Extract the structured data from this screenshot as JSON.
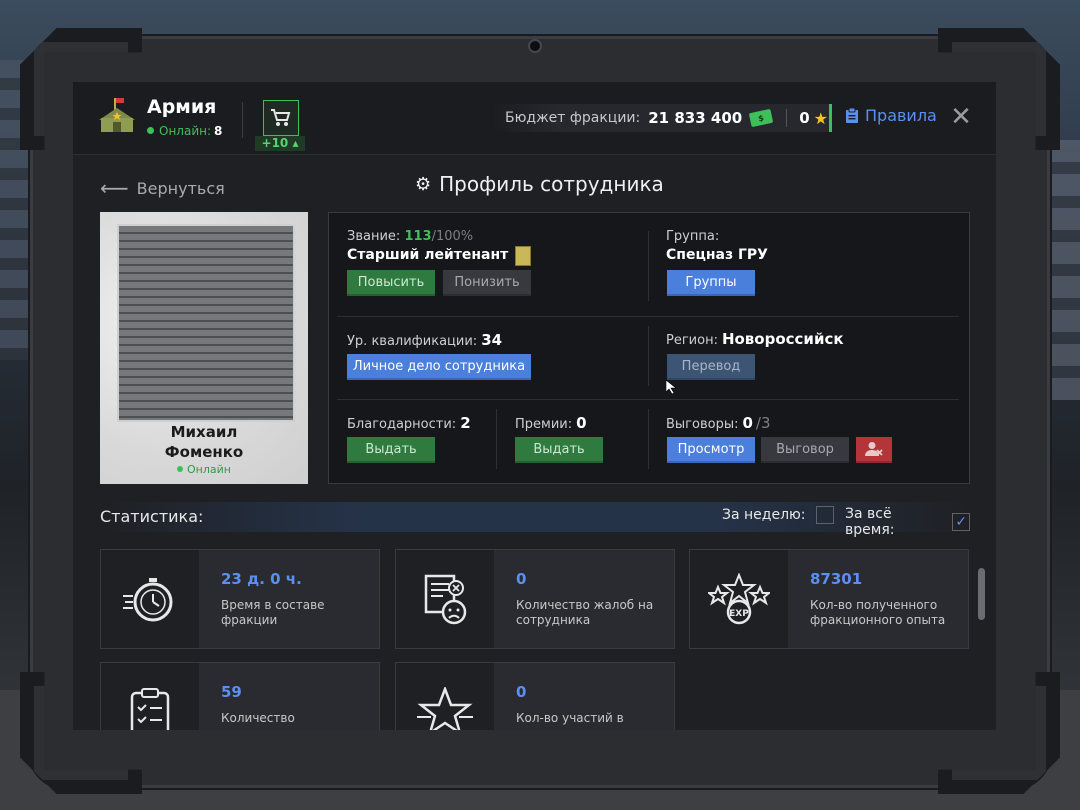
{
  "header": {
    "faction_name": "Армия",
    "online_label": "Онлайн:",
    "online_count": "8",
    "shop_bonus": "+10",
    "budget_label": "Бюджет фракции:",
    "budget_value": "21 833 400",
    "money_icon_text": "$",
    "stars_value": "0",
    "rules_label": "Правила"
  },
  "nav": {
    "back_label": "Вернуться",
    "page_title": "Профиль сотрудника"
  },
  "profile": {
    "first_name": "Михаил",
    "last_name": "Фоменко",
    "status": "Онлайн"
  },
  "info": {
    "rank_label": "Звание:",
    "rank_progress": "113",
    "rank_progress_max": "/100%",
    "rank_name": "Старший лейтенант",
    "promote_btn": "Повысить",
    "demote_btn": "Понизить",
    "group_label": "Группа:",
    "group_name": "Спецназ ГРУ",
    "groups_btn": "Группы",
    "qual_label": "Ур. квалификации:",
    "qual_value": "34",
    "personal_file_btn": "Личное дело сотрудника",
    "region_label": "Регион:",
    "region_name": "Новороссийск",
    "transfer_btn": "Перевод",
    "thanks_label": "Благодарности:",
    "thanks_value": "2",
    "thanks_btn": "Выдать",
    "bonus_label": "Премии:",
    "bonus_value": "0",
    "bonus_btn": "Выдать",
    "reprimand_label": "Выговоры:",
    "reprimand_value": "0",
    "reprimand_max": "/3",
    "view_btn": "Просмотр",
    "reprimand_btn": "Выговор"
  },
  "stats": {
    "title": "Статистика:",
    "week_label": "За неделю:",
    "all_time_label": "За всё время:",
    "week_checked": false,
    "all_time_checked": true,
    "cards": [
      {
        "value": "23 д. 0 ч.",
        "desc": "Время в составе фракции",
        "icon": "stopwatch-icon"
      },
      {
        "value": "0",
        "desc": "Количество жалоб на сотрудника",
        "icon": "complaint-icon"
      },
      {
        "value": "87301",
        "desc": "Кол-во полученного фракционного опыта",
        "icon": "exp-stars-icon"
      },
      {
        "value": "59",
        "desc": "Количество",
        "icon": "clipboard-icon"
      },
      {
        "value": "0",
        "desc": "Кол-во участий в",
        "icon": "star-icon"
      }
    ]
  },
  "colors": {
    "accent_green": "#3fbf5a",
    "accent_blue": "#5b8ff0",
    "danger_red": "#b3353a",
    "star_yellow": "#f5c518"
  }
}
